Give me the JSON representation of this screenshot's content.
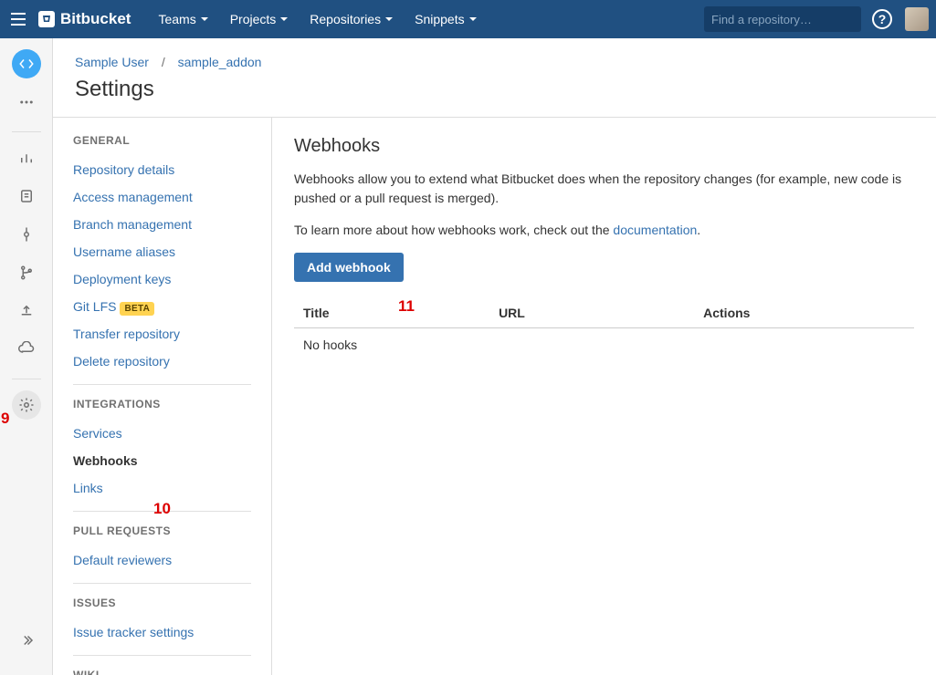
{
  "topbar": {
    "brand": "Bitbucket",
    "nav": [
      "Teams",
      "Projects",
      "Repositories",
      "Snippets"
    ],
    "search_placeholder": "Find a repository…"
  },
  "breadcrumb": {
    "user": "Sample User",
    "repo": "sample_addon"
  },
  "page_title": "Settings",
  "sidebar": {
    "sections": [
      {
        "title": "GENERAL",
        "items": [
          {
            "label": "Repository details"
          },
          {
            "label": "Access management"
          },
          {
            "label": "Branch management"
          },
          {
            "label": "Username aliases"
          },
          {
            "label": "Deployment keys"
          },
          {
            "label": "Git LFS",
            "badge": "BETA"
          },
          {
            "label": "Transfer repository"
          },
          {
            "label": "Delete repository"
          }
        ]
      },
      {
        "title": "INTEGRATIONS",
        "items": [
          {
            "label": "Services"
          },
          {
            "label": "Webhooks",
            "active": true
          },
          {
            "label": "Links"
          }
        ]
      },
      {
        "title": "PULL REQUESTS",
        "items": [
          {
            "label": "Default reviewers"
          }
        ]
      },
      {
        "title": "ISSUES",
        "items": [
          {
            "label": "Issue tracker settings"
          }
        ]
      },
      {
        "title": "WIKI",
        "items": []
      }
    ]
  },
  "main": {
    "heading": "Webhooks",
    "intro": "Webhooks allow you to extend what Bitbucket does when the repository changes (for example, new code is pushed or a pull request is merged).",
    "learn_prefix": "To learn more about how webhooks work, check out the ",
    "learn_link": "documentation",
    "learn_suffix": ".",
    "add_button": "Add webhook",
    "table": {
      "columns": [
        "Title",
        "URL",
        "Actions"
      ],
      "empty": "No hooks"
    }
  },
  "annotations": {
    "a9": "9",
    "a10": "10",
    "a11": "11"
  }
}
